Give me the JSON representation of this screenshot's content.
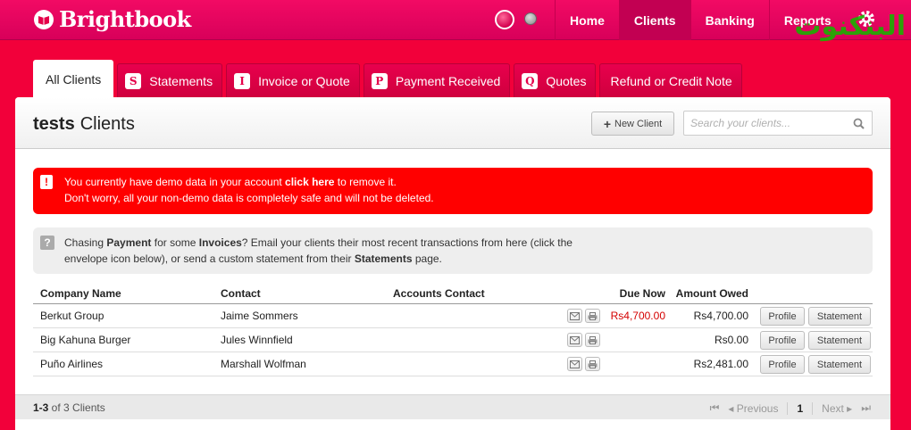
{
  "app": {
    "name": "Brightbook"
  },
  "nav": {
    "items": [
      "Home",
      "Clients",
      "Banking",
      "Reports"
    ],
    "active_index": 1
  },
  "watermark": {
    "text": "البنكنوت"
  },
  "tabs": [
    {
      "label": "All Clients",
      "badge": "",
      "active": true
    },
    {
      "label": "Statements",
      "badge": "S"
    },
    {
      "label": "Invoice or Quote",
      "badge": "I"
    },
    {
      "label": "Payment Received",
      "badge": "P"
    },
    {
      "label": "Quotes",
      "badge": "Q"
    },
    {
      "label": "Refund or Credit Note",
      "badge": ""
    }
  ],
  "panel": {
    "title_bold": "tests",
    "title_rest": "Clients",
    "new_client_label": "New Client",
    "search_placeholder": "Search your clients..."
  },
  "alert": {
    "line1_pre": "You currently have demo data in your account ",
    "line1_link": "click here",
    "line1_post": " to remove it.",
    "line2": "Don't worry, all your non-demo data is completely safe and will not be deleted."
  },
  "tip": {
    "p1": "Chasing ",
    "b1": "Payment",
    "p2": " for some ",
    "b2": "Invoices",
    "p3": "? Email your clients their most recent transactions from here (click the",
    "p4": "envelope icon below), or send a custom statement from their ",
    "b3": "Statements",
    "p5": " page."
  },
  "table": {
    "headers": {
      "company": "Company Name",
      "contact": "Contact",
      "accounts_contact": "Accounts Contact",
      "due_now": "Due Now",
      "amount_owed": "Amount Owed"
    },
    "rows": [
      {
        "company": "Berkut Group",
        "contact": "Jaime Sommers",
        "accounts_contact": "",
        "due_now": "Rs4,700.00",
        "amount_owed": "Rs4,700.00"
      },
      {
        "company": "Big Kahuna Burger",
        "contact": "Jules Winnfield",
        "accounts_contact": "",
        "due_now": "",
        "amount_owed": "Rs0.00"
      },
      {
        "company": "Puño Airlines",
        "contact": "Marshall Wolfman",
        "accounts_contact": "",
        "due_now": "",
        "amount_owed": "Rs2,481.00"
      }
    ],
    "profile_label": "Profile",
    "statement_label": "Statement"
  },
  "footer": {
    "range": "1-3",
    "of_text": " of 3 Clients",
    "previous": "◂ Previous",
    "page": "1",
    "next": "Next ▸"
  },
  "colors": {
    "brand": "#e8004d",
    "alert": "#ff0000",
    "due_red": "#d40000"
  }
}
